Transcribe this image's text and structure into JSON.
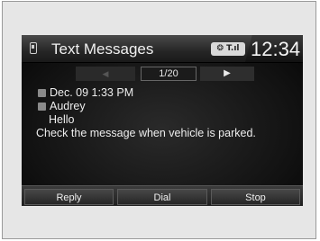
{
  "header": {
    "title": "Text Messages",
    "title_icon": "phone-icon",
    "status": "❂ T.ıl",
    "time": "12:34"
  },
  "pager": {
    "prev_symbol": "◀",
    "count": "1/20",
    "next_symbol": "▶"
  },
  "message": {
    "date": "Dec. 09 1:33 PM",
    "sender": "Audrey",
    "body": "Hello",
    "notice": "Check the message when vehicle is parked."
  },
  "actions": {
    "reply": "Reply",
    "dial": "Dial",
    "stop": "Stop"
  },
  "colors": {
    "screen_bg": "#111111",
    "text": "#eeeeee",
    "frame_bg": "#e6e6e6"
  }
}
